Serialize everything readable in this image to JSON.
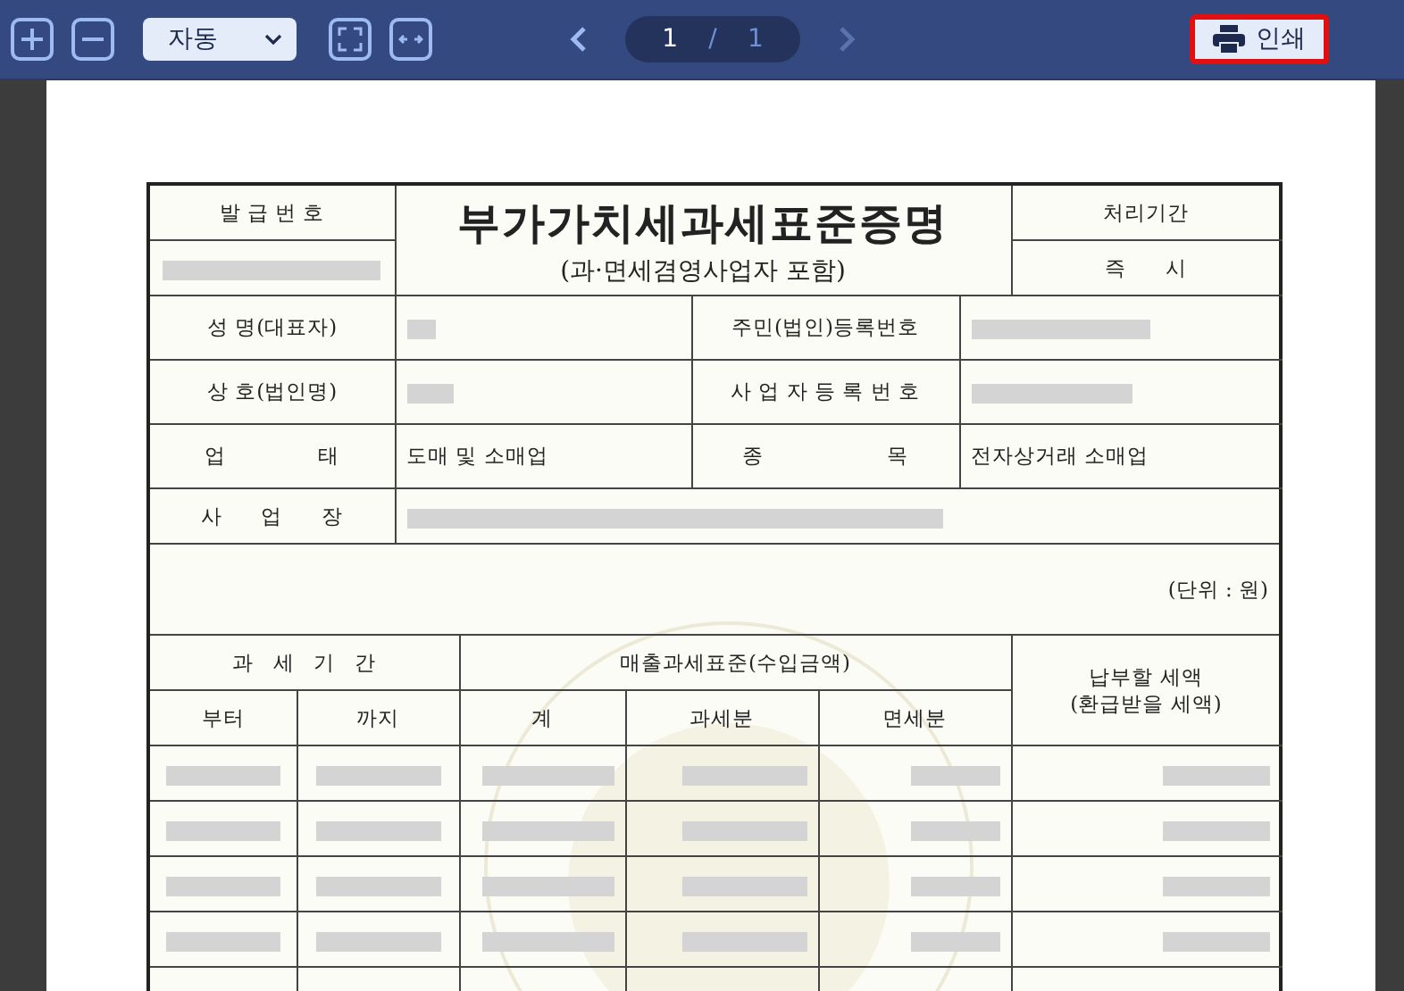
{
  "toolbar": {
    "zoom_select": {
      "value": "자동"
    },
    "page": {
      "current": "1",
      "separator": "/",
      "total": "1"
    },
    "print_button": {
      "label": "인쇄",
      "highlighted": true
    }
  },
  "document": {
    "issue_number_label": "발 급 번 호",
    "title": "부가가치세과세표준증명",
    "subtitle": "(과·면세겸영사업자 포함)",
    "processing_label": "처리기간",
    "processing_value": "즉      시",
    "info_rows": [
      {
        "label": "성 명(대표자)",
        "value": "",
        "label2": "주민(법인)등록번호",
        "value2": ""
      },
      {
        "label": "상 호(법인명)",
        "value": "",
        "label2": "사 업 자 등 록 번 호",
        "value2": ""
      },
      {
        "label": "업              태",
        "value": "도매 및 소매업",
        "label2": "종                   목",
        "value2": "전자상거래 소매업"
      }
    ],
    "address_label": "사      업      장",
    "unit": "(단위 : 원)",
    "period_header": "과   세   기   간",
    "sales_header": "매출과세표준(수입금액)",
    "tax_header": "납부할 세액",
    "tax_header2": "(환급받을 세액)",
    "columns": [
      "부터",
      "까지",
      "계",
      "과세분",
      "면세분"
    ]
  }
}
